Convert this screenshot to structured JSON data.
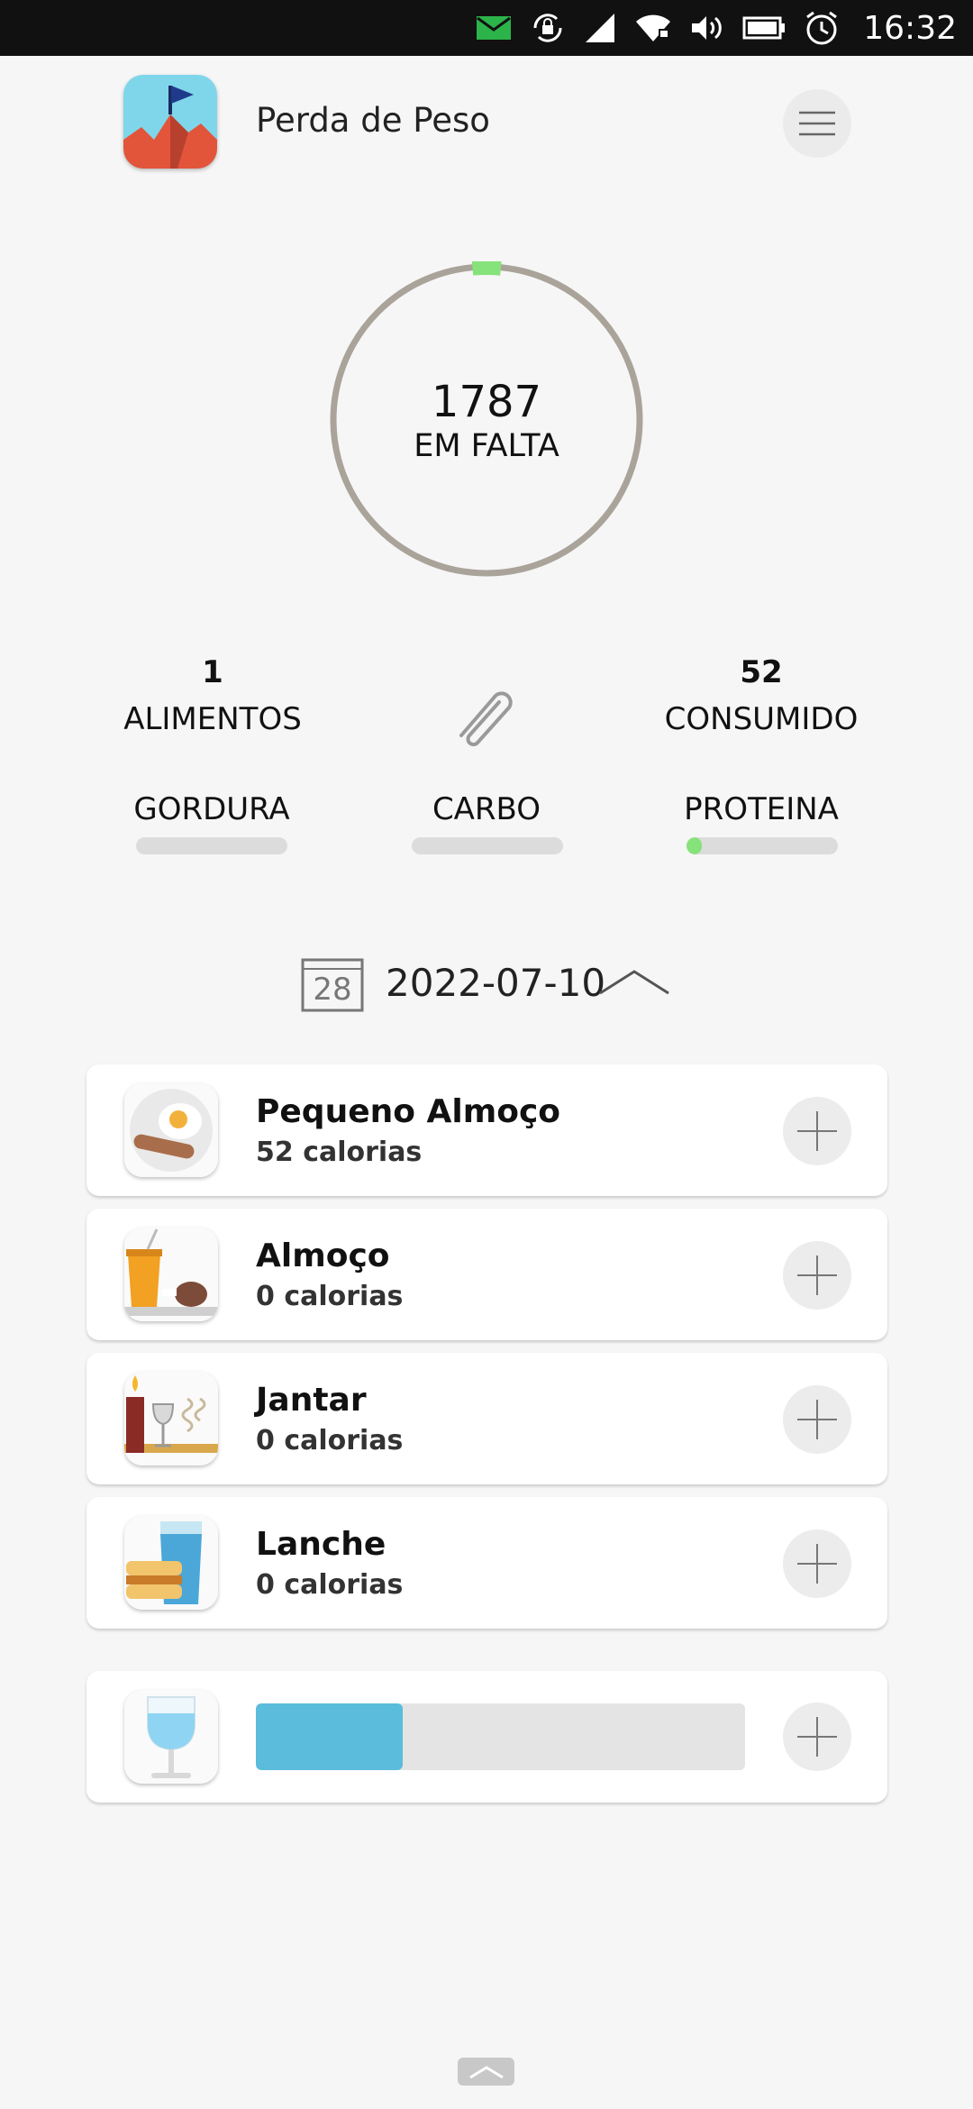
{
  "status_bar": {
    "time": "16:32",
    "icons": [
      "mail-icon",
      "lock-rotation-icon",
      "signal-icon",
      "wifi-icon",
      "volume-icon",
      "battery-icon",
      "alarm-icon"
    ]
  },
  "header": {
    "title": "Perda de Peso",
    "app_icon": "mountain-flag-icon",
    "menu_icon": "hamburger-menu-icon"
  },
  "calories": {
    "remaining": "1787",
    "remaining_label": "EM FALTA",
    "ring_progress": 0.03,
    "ring_color": "#a9a39a",
    "progress_color": "#86e27a"
  },
  "stats": {
    "foods_count": "1",
    "foods_label": "ALIMENTOS",
    "consumed_value": "52",
    "consumed_label": "CONSUMIDO",
    "attach_icon": "paperclip-icon"
  },
  "macros": [
    {
      "label": "GORDURA",
      "progress": 0
    },
    {
      "label": "CARBO",
      "progress": 0
    },
    {
      "label": "PROTEINA",
      "progress": 0.05
    }
  ],
  "date": {
    "calendar_day": "28",
    "value": "2022-07-10",
    "toggle_icon": "chevron-up-icon"
  },
  "meals": [
    {
      "name": "Pequeno Almoço",
      "calories": "52 calorias",
      "icon": "breakfast-icon"
    },
    {
      "name": "Almoço",
      "calories": "0 calorias",
      "icon": "lunch-icon"
    },
    {
      "name": "Jantar",
      "calories": "0 calorias",
      "icon": "dinner-icon"
    },
    {
      "name": "Lanche",
      "calories": "0 calorias",
      "icon": "snack-icon"
    }
  ],
  "water": {
    "icon": "water-glass-icon",
    "progress": 0.3,
    "fill_color": "#5bbcdc"
  }
}
